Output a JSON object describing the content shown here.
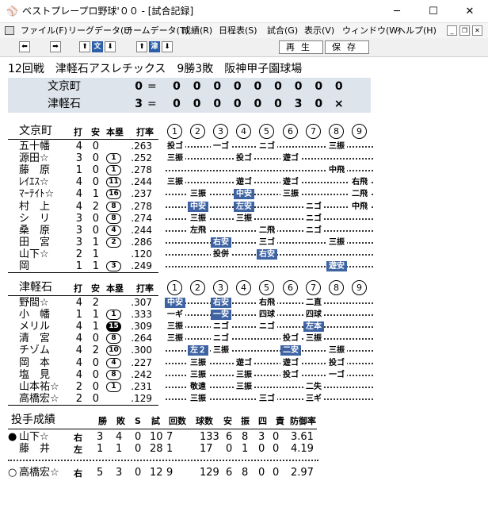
{
  "window": {
    "title": "ベストプレープロ野球'００ - [試合記録]",
    "minimize": "─",
    "maximize": "☐",
    "close": "✕"
  },
  "menu": [
    "ファイル(F)",
    "リーグデータ(L)",
    "チームデータ(T)",
    "成績(R)",
    "日程表(S)",
    "試合(G)",
    "表示(V)",
    "ウィンドウ(W)",
    "ヘルプ(H)"
  ],
  "toolbar": {
    "team1": "文",
    "team2": "津",
    "replay": "再生",
    "save": "保存"
  },
  "game": {
    "info": "12回戦　津軽石アスレチックス　9勝3敗　阪神甲子園球場"
  },
  "scoreboard": [
    {
      "team": "文京町",
      "total": "0",
      "eq": "=",
      "innings": [
        "0",
        "0",
        "0",
        "0",
        "0",
        "0",
        "0",
        "0",
        "0"
      ]
    },
    {
      "team": "津軽石",
      "total": "3",
      "eq": "=",
      "innings": [
        "0",
        "0",
        "0",
        "0",
        "0",
        "0",
        "3",
        "0",
        "×"
      ]
    }
  ],
  "batting_headers": {
    "ab": "打",
    "h": "安",
    "hr": "本塁",
    "avg": "打率",
    "innings": [
      "1",
      "2",
      "3",
      "4",
      "5",
      "6",
      "7",
      "8",
      "9"
    ]
  },
  "away": {
    "team": "文京町",
    "players": [
      {
        "name": "五十幡",
        "ab": "4",
        "h": "0",
        "hr": "",
        "avg": ".263",
        "pa": [
          [
            "投ゴ",
            0
          ],
          [
            "一ゴ",
            2
          ],
          [
            "ニゴ",
            4
          ],
          [
            "三振",
            7
          ]
        ]
      },
      {
        "name": "源田☆",
        "ab": "3",
        "h": "0",
        "hr": "1",
        "avg": ".252",
        "pa": [
          [
            "三振",
            0
          ],
          [
            "投ゴ",
            3
          ],
          [
            "遊ゴ",
            5
          ]
        ]
      },
      {
        "name": "藤　原",
        "ab": "1",
        "h": "0",
        "hr": "1",
        "avg": ".278",
        "pa": [
          [
            "中飛",
            7
          ]
        ]
      },
      {
        "name": "ﾚｲｴｽ☆",
        "ab": "4",
        "h": "0",
        "hr": "11",
        "avg": ".244",
        "pa": [
          [
            "三振",
            0
          ],
          [
            "遊ゴ",
            3
          ],
          [
            "遊ゴ",
            5
          ],
          [
            "右飛",
            8
          ]
        ]
      },
      {
        "name": "ﾏｰﾃｲﾄ☆",
        "ab": "4",
        "h": "1",
        "hr": "16",
        "avg": ".237",
        "pa": [
          [
            "三振",
            1
          ],
          [
            "中安",
            3
          ],
          [
            "三振",
            5
          ],
          [
            "二飛",
            8
          ]
        ]
      },
      {
        "name": "村　上",
        "ab": "4",
        "h": "2",
        "hr": "8",
        "avg": ".278",
        "pa": [
          [
            "中安",
            1
          ],
          [
            "左安",
            3
          ],
          [
            "ニゴ",
            6
          ],
          [
            "中飛",
            8
          ]
        ]
      },
      {
        "name": "シ　リ",
        "ab": "3",
        "h": "0",
        "hr": "8",
        "avg": ".274",
        "pa": [
          [
            "三振",
            1
          ],
          [
            "三振",
            3
          ],
          [
            "ニゴ",
            6
          ]
        ]
      },
      {
        "name": "桑　原",
        "ab": "3",
        "h": "0",
        "hr": "4",
        "avg": ".244",
        "pa": [
          [
            "左飛",
            1
          ],
          [
            "二飛",
            4
          ],
          [
            "ニゴ",
            6
          ]
        ]
      },
      {
        "name": "田　宮",
        "ab": "3",
        "h": "1",
        "hr": "2",
        "avg": ".286",
        "pa": [
          [
            "右安",
            2
          ],
          [
            "三ゴ",
            4
          ],
          [
            "三振",
            7
          ]
        ]
      },
      {
        "name": "山下☆",
        "ab": "2",
        "h": "1",
        "hr": "",
        "avg": ".120",
        "pa": [
          [
            "投併",
            2
          ],
          [
            "右安",
            4
          ]
        ]
      },
      {
        "name": "岡",
        "ab": "1",
        "h": "1",
        "hr": "3",
        "avg": ".249",
        "pa": [
          [
            "遊安",
            7
          ]
        ]
      }
    ]
  },
  "home": {
    "team": "津軽石",
    "players": [
      {
        "name": "野間☆",
        "ab": "4",
        "h": "2",
        "hr": "",
        "avg": ".307",
        "pa": [
          [
            "中安",
            0
          ],
          [
            "右安",
            2
          ],
          [
            "右飛",
            4
          ],
          [
            "二直",
            6
          ]
        ]
      },
      {
        "name": "小　幡",
        "ab": "1",
        "h": "1",
        "hr": "1",
        "avg": ".333",
        "pa": [
          [
            "一ギ",
            0
          ],
          [
            "一安",
            2
          ],
          [
            "四球",
            4
          ],
          [
            "四球",
            6
          ]
        ]
      },
      {
        "name": "メリル",
        "ab": "4",
        "h": "1",
        "hr": "15",
        "avg": ".309",
        "pa": [
          [
            "三振",
            0
          ],
          [
            "ニゴ",
            2
          ],
          [
            "ニゴ",
            4
          ],
          [
            "左本",
            6
          ]
        ]
      },
      {
        "name": "清　宮",
        "ab": "4",
        "h": "0",
        "hr": "8",
        "avg": ".264",
        "pa": [
          [
            "三振",
            0
          ],
          [
            "ニゴ",
            2
          ],
          [
            "投ゴ",
            5
          ],
          [
            "三振",
            6
          ]
        ]
      },
      {
        "name": "チゾム",
        "ab": "4",
        "h": "2",
        "hr": "10",
        "avg": ".300",
        "pa": [
          [
            "左２",
            1
          ],
          [
            "三振",
            2
          ],
          [
            "二安",
            5
          ],
          [
            "三振",
            7
          ]
        ]
      },
      {
        "name": "岡　本",
        "ab": "4",
        "h": "0",
        "hr": "4",
        "avg": ".227",
        "pa": [
          [
            "三振",
            1
          ],
          [
            "遊ゴ",
            3
          ],
          [
            "遊ゴ",
            5
          ],
          [
            "投ゴ",
            7
          ]
        ]
      },
      {
        "name": "塩　見",
        "ab": "4",
        "h": "0",
        "hr": "8",
        "avg": ".242",
        "pa": [
          [
            "三振",
            1
          ],
          [
            "三振",
            3
          ],
          [
            "投ゴ",
            5
          ],
          [
            "一ゴ",
            7
          ]
        ]
      },
      {
        "name": "山本祐☆",
        "ab": "2",
        "h": "0",
        "hr": "1",
        "avg": ".231",
        "pa": [
          [
            "敬遠",
            1
          ],
          [
            "三振",
            3
          ],
          [
            "二失",
            6
          ]
        ]
      },
      {
        "name": "高橋宏☆",
        "ab": "2",
        "h": "0",
        "hr": "",
        "avg": ".129",
        "pa": [
          [
            "三振",
            1
          ],
          [
            "三ゴ",
            4
          ],
          [
            "三ギ",
            6
          ]
        ]
      }
    ]
  },
  "pitching": {
    "title": "投手成績",
    "headers": [
      "勝",
      "敗",
      "S",
      "試",
      "回数",
      "球数",
      "安",
      "振",
      "四",
      "責",
      "防御率"
    ],
    "pitchers": [
      {
        "mark": "●",
        "name": "山下☆",
        "hand": "右",
        "w": "3",
        "l": "4",
        "s": "0",
        "g": "10",
        "ip": "7",
        "np": "133",
        "h": "6",
        "k": "8",
        "bb": "3",
        "er": "0",
        "era": "3.61"
      },
      {
        "mark": "",
        "name": "藤　井",
        "hand": "左",
        "w": "1",
        "l": "1",
        "s": "0",
        "g": "28",
        "ip": "1",
        "np": "17",
        "h": "0",
        "k": "1",
        "bb": "0",
        "er": "0",
        "era": "4.19"
      },
      {
        "mark": "○",
        "name": "高橋宏☆",
        "hand": "右",
        "w": "5",
        "l": "3",
        "s": "0",
        "g": "12",
        "ip": "9",
        "np": "129",
        "h": "6",
        "k": "8",
        "bb": "0",
        "er": "0",
        "era": "2.97"
      }
    ]
  },
  "colors": {
    "scorebg": "#dde4ec",
    "highlight": "#3e63a3"
  }
}
